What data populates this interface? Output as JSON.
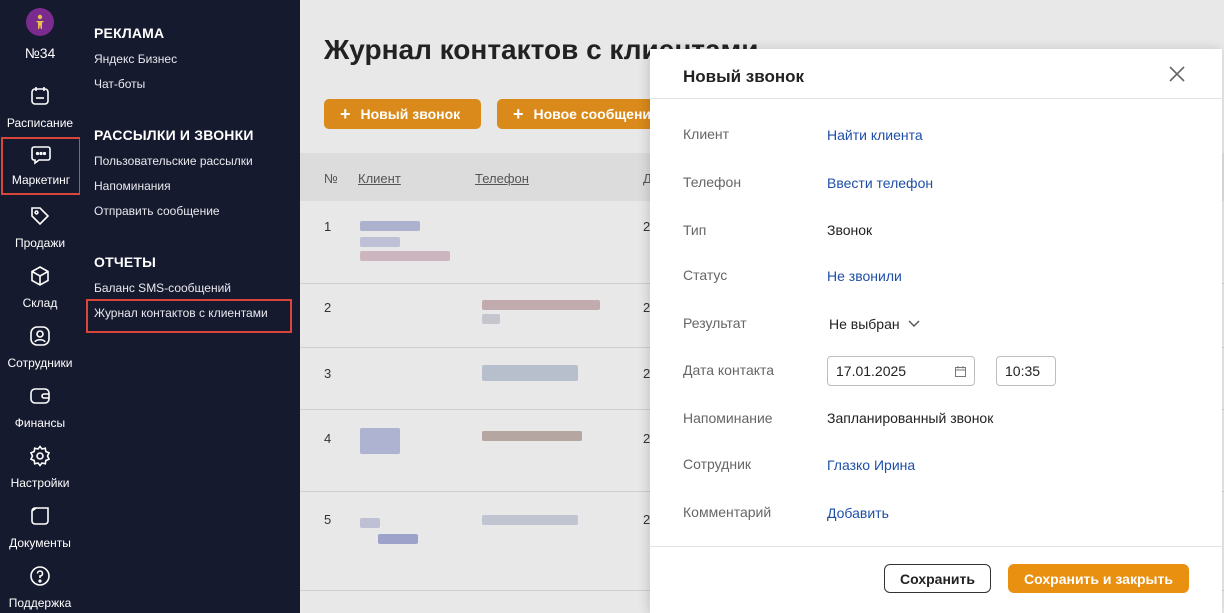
{
  "rail": {
    "club_number": "№34",
    "items": [
      {
        "label": "Расписание",
        "icon": "calendar-icon"
      },
      {
        "label": "Маркетинг",
        "icon": "chat-icon",
        "active": true
      },
      {
        "label": "Продажи",
        "icon": "tag-icon"
      },
      {
        "label": "Склад",
        "icon": "box-icon"
      },
      {
        "label": "Сотрудники",
        "icon": "user-icon"
      },
      {
        "label": "Финансы",
        "icon": "wallet-icon"
      },
      {
        "label": "Настройки",
        "icon": "gear-icon"
      },
      {
        "label": "Документы",
        "icon": "document-icon"
      },
      {
        "label": "Поддержка",
        "icon": "help-icon"
      }
    ]
  },
  "submenu": {
    "sections": [
      {
        "title": "РЕКЛАМА",
        "links": [
          "Яндекс Бизнес",
          "Чат-боты"
        ]
      },
      {
        "title": "РАССЫЛКИ И ЗВОНКИ",
        "links": [
          "Пользовательские рассылки",
          "Напоминания",
          "Отправить сообщение"
        ]
      },
      {
        "title": "ОТЧЕТЫ",
        "links": [
          "Баланс SMS-сообщений",
          "Журнал контактов с клиентами"
        ]
      }
    ]
  },
  "main": {
    "title": "Журнал контактов с клиентами",
    "new_call_button": "Новый звонок",
    "new_message_button": "Новое сообщение",
    "columns": [
      "№",
      "Клиент",
      "Телефон",
      "Д"
    ],
    "rows": [
      {
        "num": "1",
        "date": "2"
      },
      {
        "num": "2",
        "date": "2"
      },
      {
        "num": "3",
        "date": "2"
      },
      {
        "num": "4",
        "date": "2"
      },
      {
        "num": "5",
        "date": "2"
      }
    ]
  },
  "modal": {
    "title": "Новый звонок",
    "fields": {
      "client_label": "Клиент",
      "client_value": "Найти клиента",
      "phone_label": "Телефон",
      "phone_value": "Ввести телефон",
      "type_label": "Тип",
      "type_value": "Звонок",
      "status_label": "Статус",
      "status_value": "Не звонили",
      "result_label": "Результат",
      "result_value": "Не выбран",
      "date_label": "Дата контакта",
      "date_value": "17.01.2025",
      "time_value": "10:35",
      "reminder_label": "Напоминание",
      "reminder_value": "Запланированный звонок",
      "employee_label": "Сотрудник",
      "employee_value": "Глазко Ирина",
      "comment_label": "Комментарий",
      "comment_value": "Добавить"
    },
    "save_button": "Сохранить",
    "save_close_button": "Сохранить и закрыть"
  },
  "colors": {
    "sidebar_bg": "#161a2e",
    "accent_orange": "#ea9010",
    "link_blue": "#1e4fa8",
    "highlight_red": "#d9473a"
  }
}
